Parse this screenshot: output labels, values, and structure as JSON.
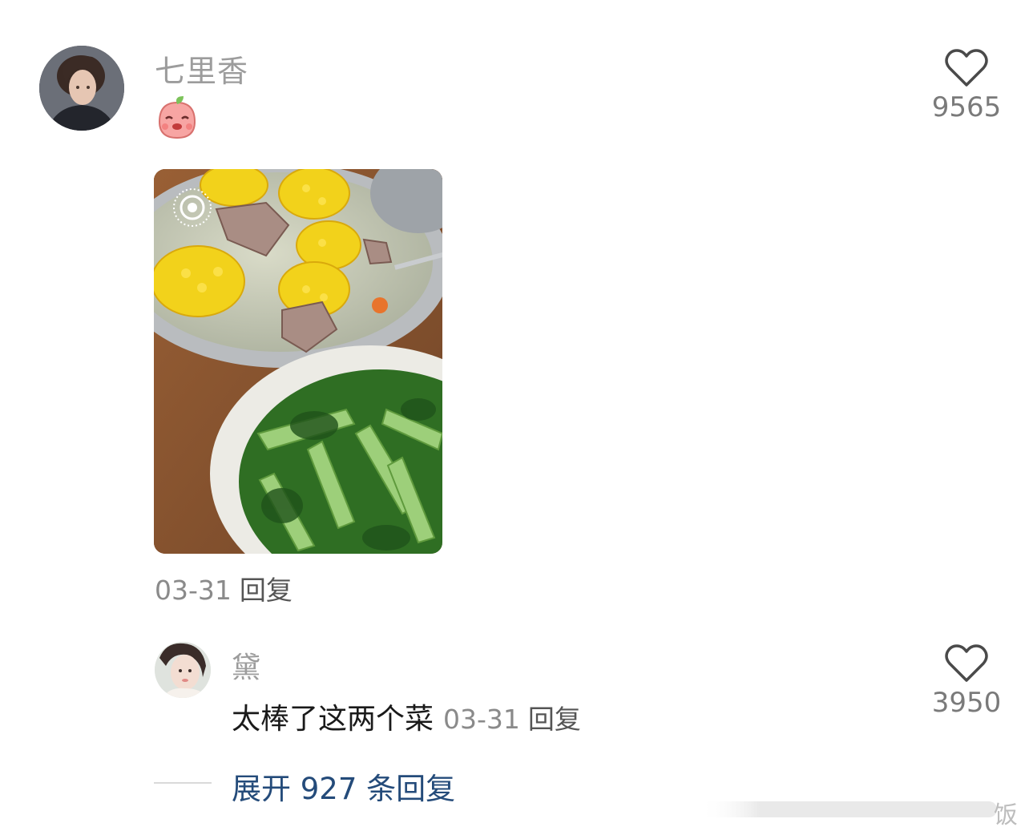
{
  "comment": {
    "username": "七里香",
    "date": "03-31",
    "reply_label": "回复",
    "likes": "9565",
    "sticker_icon": "smiling-peach-sticker-icon",
    "photo_description_icon": "live-photo-icon"
  },
  "sub_reply": {
    "username": "黛",
    "text": "太棒了这两个菜",
    "date": "03-31",
    "reply_label": "回复",
    "likes": "3950"
  },
  "expand": {
    "label": "展开 927 条回复"
  },
  "watermark": {
    "text": "饭"
  },
  "colors": {
    "username": "#9c9c9c",
    "expand_link": "#244b7a",
    "meta": "#8a8a8a"
  }
}
